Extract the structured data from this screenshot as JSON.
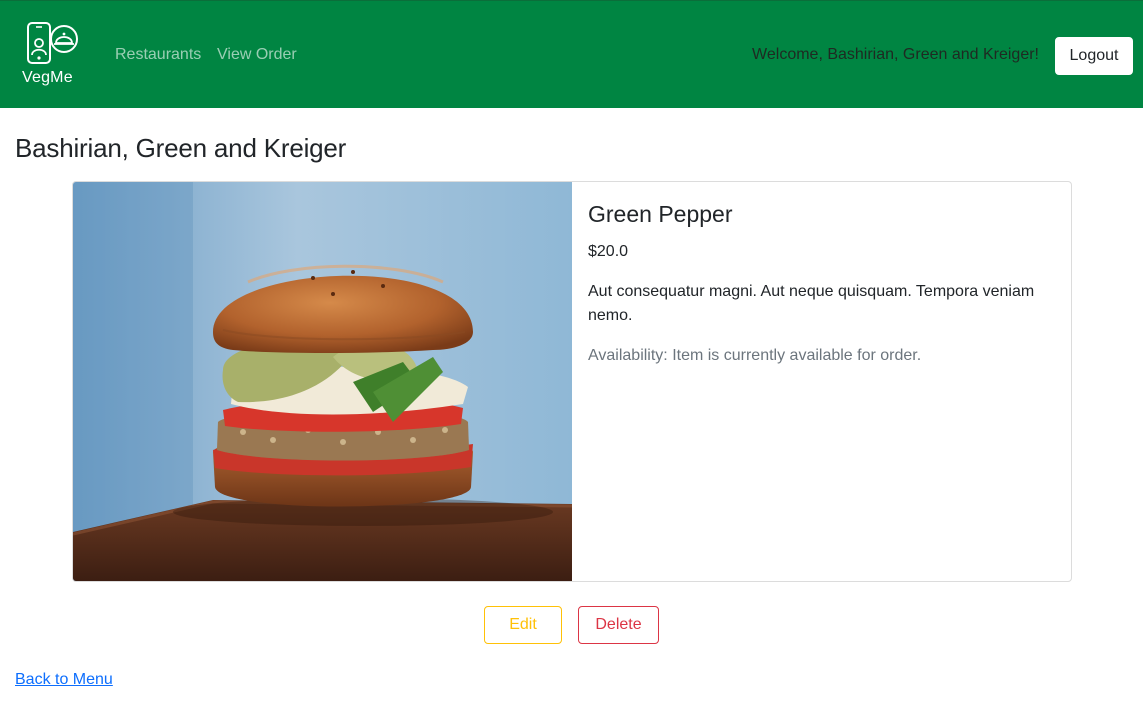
{
  "navbar": {
    "brand_name": "VegMe",
    "links": [
      {
        "label": "Restaurants"
      },
      {
        "label": "View Order"
      }
    ],
    "welcome_text": "Welcome, Bashirian, Green and Kreiger!",
    "logout_label": "Logout",
    "background_color": "#008542",
    "logo_icon": "phone-with-cloche-icon"
  },
  "page": {
    "title": "Bashirian, Green and Kreiger"
  },
  "item": {
    "image_icon": "burger-photo",
    "name": "Green Pepper",
    "price": "$20.0",
    "description": "Aut consequatur magni. Aut neque quisquam. Tempora veniam nemo.",
    "availability": "Availability: Item is currently available for order."
  },
  "actions": {
    "edit_label": "Edit",
    "delete_label": "Delete",
    "edit_color": "#ffc107",
    "delete_color": "#dc3545"
  },
  "footer": {
    "back_label": "Back to Menu",
    "link_color": "#0d6efd"
  }
}
